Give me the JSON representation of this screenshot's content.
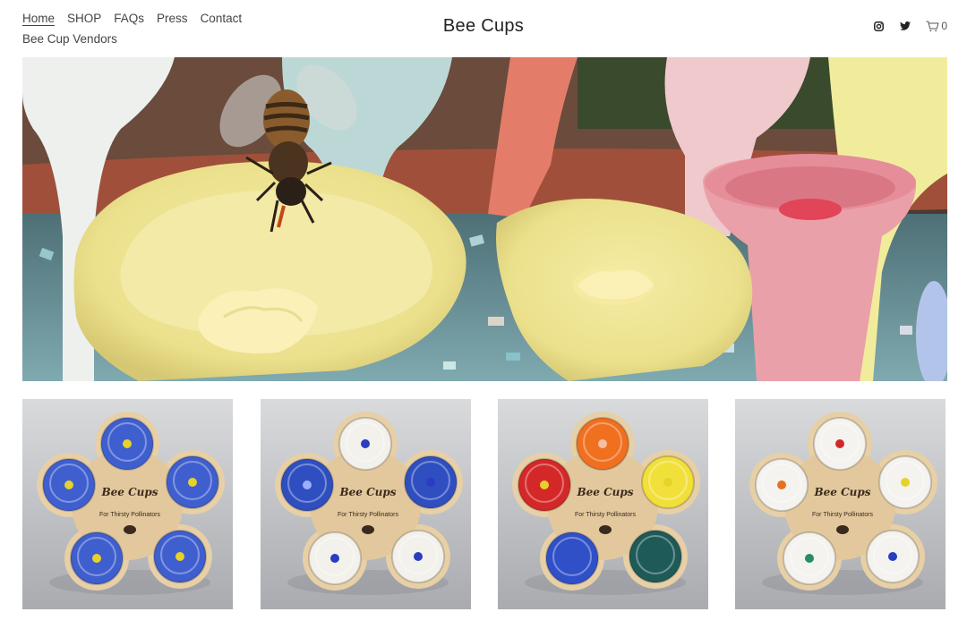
{
  "nav": {
    "items": [
      {
        "label": "Home",
        "active": true
      },
      {
        "label": "SHOP"
      },
      {
        "label": "FAQs"
      },
      {
        "label": "Press"
      },
      {
        "label": "Contact"
      },
      {
        "label": "Bee Cup Vendors"
      }
    ]
  },
  "site": {
    "title": "Bee Cups"
  },
  "header_icons": [
    "instagram-icon",
    "twitter-icon",
    "cart-icon"
  ],
  "cart": {
    "count": "0"
  },
  "hero": {
    "alt": "hero-image"
  },
  "products": [
    {
      "board_title": "Bee Cups",
      "board_tagline": "For Thirsty Pollinators",
      "cup_colors": [
        "#3f5fcf",
        "#3f5fcf",
        "#3f5fcf",
        "#3f5fcf",
        "#3f5fcf"
      ],
      "center_colors": [
        "#e6d22a",
        "#e6d22a",
        "#e6d22a",
        "#e6d22a",
        "#e6d22a"
      ]
    },
    {
      "board_title": "Bee Cups",
      "board_tagline": "For Thirsty Pollinators",
      "cup_colors": [
        "#f3f1ec",
        "#2f4fc0",
        "#2f4fc0",
        "#f3f1ec",
        "#f3f1ec"
      ],
      "center_colors": [
        "#2a3cc0",
        "#9ab0ff",
        "#2a3cc0",
        "#2a3cc0",
        "#2a3cc0"
      ]
    },
    {
      "board_title": "Bee Cups",
      "board_tagline": "For Thirsty Pollinators",
      "cup_colors": [
        "#f07020",
        "#d42828",
        "#f2e03a",
        "#3050c8",
        "#1e5a58"
      ],
      "center_colors": [
        "#f5c0a0",
        "#e6d22a",
        "#e6d22a",
        "#3050c8",
        "#1e5a58"
      ]
    },
    {
      "board_title": "Bee Cups",
      "board_tagline": "For Thirsty Pollinators",
      "cup_colors": [
        "#f4f3ef",
        "#f4f3ef",
        "#f4f3ef",
        "#f4f3ef",
        "#f4f3ef"
      ],
      "center_colors": [
        "#d42828",
        "#e87020",
        "#e6d22a",
        "#2a8a6a",
        "#2a3cc0"
      ]
    }
  ]
}
